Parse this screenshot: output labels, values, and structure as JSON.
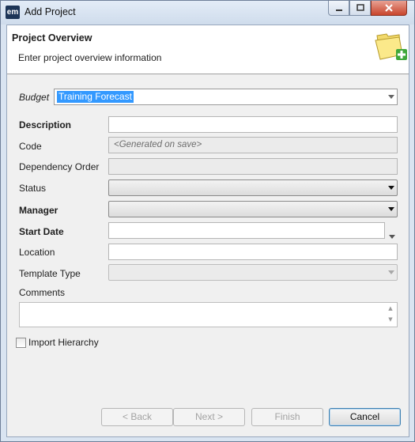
{
  "window": {
    "app_icon_text": "em",
    "title": "Add Project"
  },
  "header": {
    "title": "Project Overview",
    "subtitle": "Enter project overview information",
    "icon": "folder-add-icon"
  },
  "form": {
    "budget": {
      "label": "Budget",
      "value": "Training Forecast"
    },
    "description": {
      "label": "Description",
      "value": ""
    },
    "code": {
      "label": "Code",
      "placeholder": "<Generated on save>"
    },
    "dependency_order": {
      "label": "Dependency Order",
      "value": ""
    },
    "status": {
      "label": "Status",
      "value": ""
    },
    "manager": {
      "label": "Manager",
      "value": ""
    },
    "start_date": {
      "label": "Start Date",
      "value": ""
    },
    "location": {
      "label": "Location",
      "value": ""
    },
    "template_type": {
      "label": "Template Type",
      "value": ""
    },
    "comments": {
      "label": "Comments",
      "value": ""
    },
    "import_hierarchy": {
      "label": "Import Hierarchy",
      "checked": false
    }
  },
  "buttons": {
    "back": "< Back",
    "next": "Next >",
    "finish": "Finish",
    "cancel": "Cancel"
  }
}
